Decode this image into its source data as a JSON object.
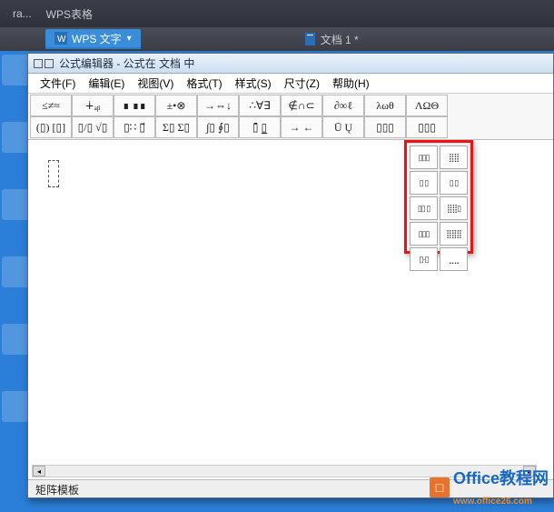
{
  "taskbar": {
    "items": [
      "ra...",
      "WPS表格"
    ]
  },
  "wps_tab": {
    "label": "WPS 文字",
    "doc_title": "文档 1 *"
  },
  "eq_window": {
    "title": "公式编辑器 - 公式在 文档 中",
    "status": "矩阵模板"
  },
  "menubar": [
    "文件(F)",
    "编辑(E)",
    "视图(V)",
    "格式(T)",
    "样式(S)",
    "尺寸(Z)",
    "帮助(H)"
  ],
  "toolbar": {
    "row1": [
      "≤≠≈",
      "∔ₐᵦ",
      "∎ ∎∎",
      "±•⊗",
      "→⇔↓",
      "∴∀∃",
      "∉∩⊂",
      "∂∞ℓ",
      "λωθ",
      "ΛΩΘ"
    ],
    "row2": [
      "(▯) [▯]",
      "▯/▯ √▯",
      "▯∷ ▯⃗",
      "Σ▯ Σ▯",
      "∫▯ ∮▯",
      "▯̄ ▯̲",
      "→ ←",
      "Ū Ų",
      "▯▯▯",
      "▯▯▯"
    ]
  },
  "matrix_dropdown": {
    "cells": [
      "▯▯▯",
      "⣿⣿",
      "▯  ▯",
      "▯  ▯",
      "▯▯  ▯",
      "⣿⣿▯",
      "▯▯▯",
      "⣿⣿⣿",
      "▯·▯",
      "⣀⣀"
    ]
  },
  "watermark": {
    "brand": "Office",
    "suffix": "教程网",
    "url": "www.office26.com"
  }
}
